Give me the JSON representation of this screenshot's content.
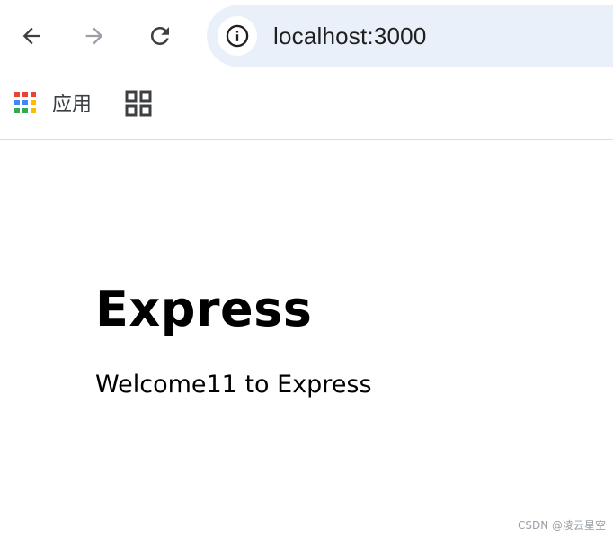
{
  "browser": {
    "url": "localhost:3000",
    "bookmarks": {
      "apps_label": "应用"
    },
    "icons": {
      "back": "back-arrow-icon",
      "forward": "forward-arrow-icon",
      "reload": "reload-icon",
      "site_info": "info-icon",
      "apps": "apps-grid-icon",
      "bookmark": "grid-icon"
    },
    "colors": {
      "omnibox_bg": "#eaf0f9",
      "apps_red": "#ea4335",
      "apps_blue": "#4285f4",
      "apps_yellow": "#fbbc04",
      "apps_green": "#34a853"
    }
  },
  "page": {
    "heading": "Express",
    "paragraph": "Welcome11 to Express"
  },
  "watermark": "CSDN @凌云星空"
}
